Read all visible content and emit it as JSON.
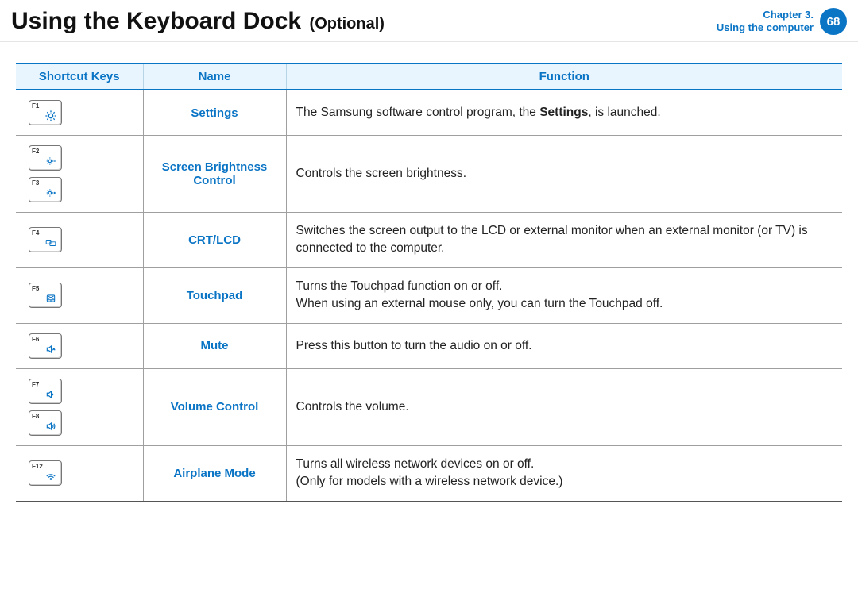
{
  "header": {
    "title_main": "Using the Keyboard Dock",
    "title_sub": "(Optional)",
    "chapter_line1": "Chapter 3.",
    "chapter_line2": "Using the computer",
    "page_number": "68"
  },
  "table": {
    "headers": {
      "shortcut": "Shortcut Keys",
      "name": "Name",
      "function": "Function"
    },
    "rows": [
      {
        "keys": [
          "F1"
        ],
        "icons": [
          "settings"
        ],
        "name": "Settings",
        "function_pre": "The Samsung software control program, the ",
        "function_bold": "Settings",
        "function_post": ", is launched."
      },
      {
        "keys": [
          "F2",
          "F3"
        ],
        "icons": [
          "brightness-down",
          "brightness-up"
        ],
        "name": "Screen Brightness Control",
        "function": "Controls the screen brightness."
      },
      {
        "keys": [
          "F4"
        ],
        "icons": [
          "crt-lcd"
        ],
        "name": "CRT/LCD",
        "function": "Switches the screen output to the LCD or external monitor when an external monitor (or TV) is connected to the computer."
      },
      {
        "keys": [
          "F5"
        ],
        "icons": [
          "touchpad"
        ],
        "name": "Touchpad",
        "function_line1": "Turns the Touchpad function on or off.",
        "function_line2": "When using an external mouse only, you can turn the Touchpad off."
      },
      {
        "keys": [
          "F6"
        ],
        "icons": [
          "mute"
        ],
        "name": "Mute",
        "function": "Press this button to turn the audio on or off."
      },
      {
        "keys": [
          "F7",
          "F8"
        ],
        "icons": [
          "volume-down",
          "volume-up"
        ],
        "name": "Volume Control",
        "function": "Controls the volume."
      },
      {
        "keys": [
          "F12"
        ],
        "icons": [
          "airplane"
        ],
        "name": "Airplane Mode",
        "function_line1": "Turns all wireless network devices on or off.",
        "function_line2": "(Only for models with a wireless network device.)"
      }
    ]
  }
}
